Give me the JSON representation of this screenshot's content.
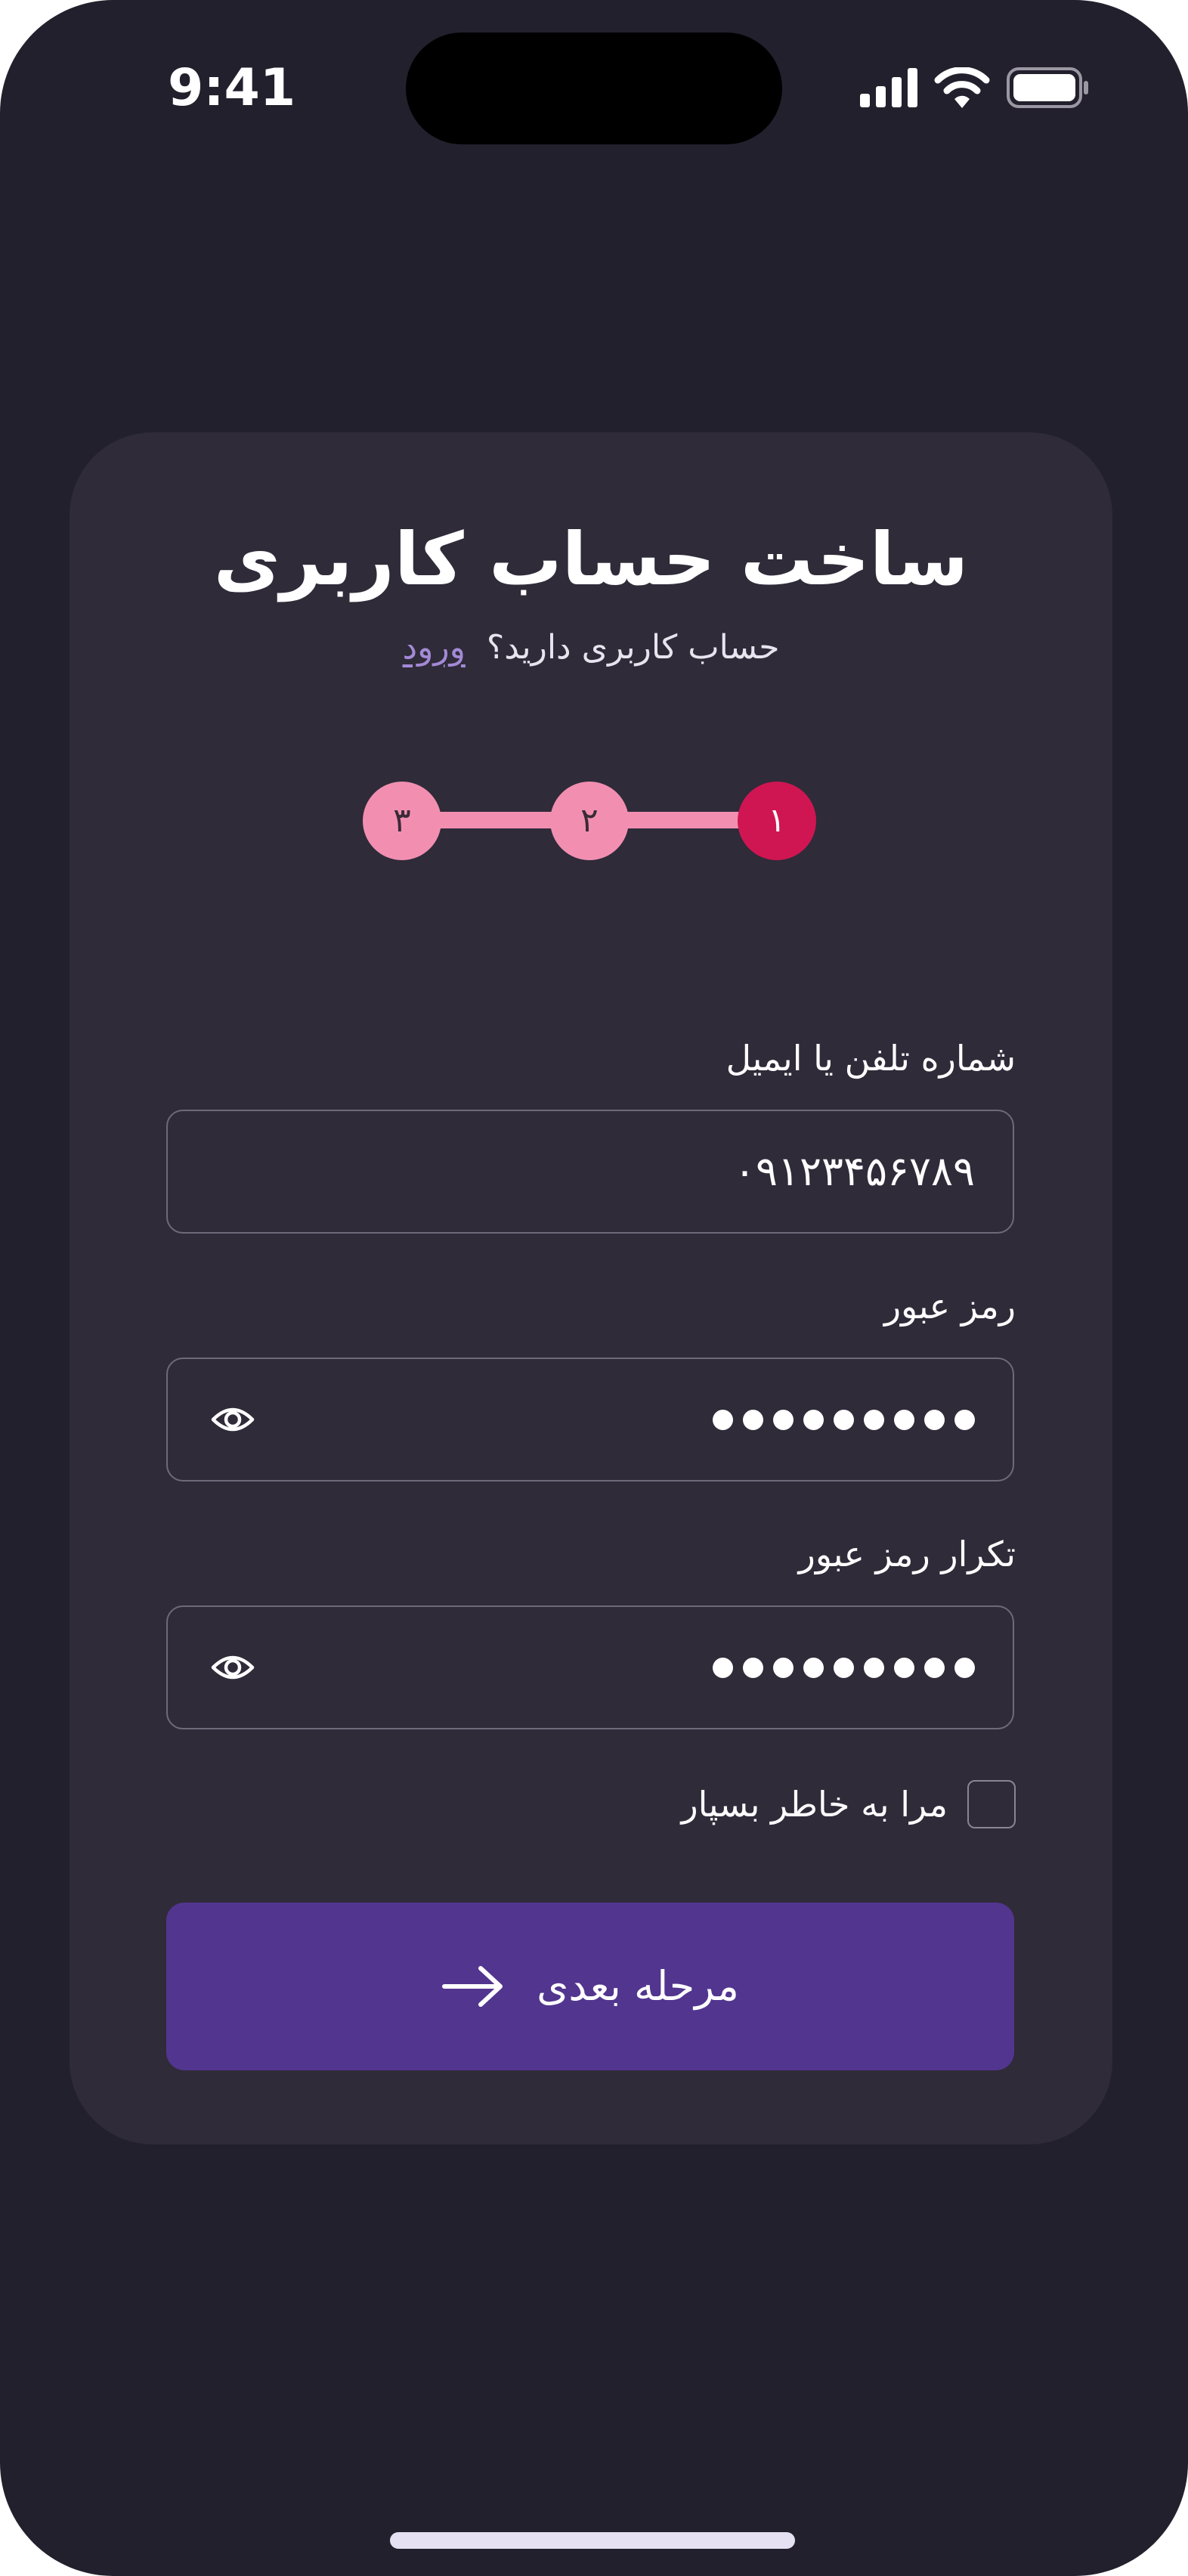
{
  "status_bar": {
    "time": "9:41",
    "icons": [
      "cellular-signal-icon",
      "wifi-icon",
      "battery-icon"
    ]
  },
  "card": {
    "title": "ساخت حساب کاربری",
    "subtitle": "حساب کاربری دارید؟",
    "login_link": "ورود"
  },
  "stepper": {
    "current_step": 1,
    "steps": [
      {
        "label": "۱",
        "state": "active"
      },
      {
        "label": "۲",
        "state": "upcoming"
      },
      {
        "label": "۳",
        "state": "upcoming"
      }
    ]
  },
  "form": {
    "phone_email": {
      "label": "شماره تلفن یا ایمیل",
      "value": "۰۹۱۲۳۴۵۶۷۸۹"
    },
    "password": {
      "label": "رمز عبور",
      "masked_length": 9,
      "toggle_icon": "eye-icon"
    },
    "confirm_password": {
      "label": "تکرار رمز عبور",
      "masked_length": 9,
      "toggle_icon": "eye-icon"
    },
    "remember_me": {
      "label": "مرا به خاطر بسپار",
      "checked": false
    },
    "next_button": {
      "label": "مرحله بعدی",
      "icon": "arrow-right-icon"
    }
  },
  "colors": {
    "background": "#23202d",
    "card": "#2f2b39",
    "accent": "#52358f",
    "step_active": "#cf1652",
    "step_inactive": "#f28fb1",
    "link": "#a38ad6"
  }
}
